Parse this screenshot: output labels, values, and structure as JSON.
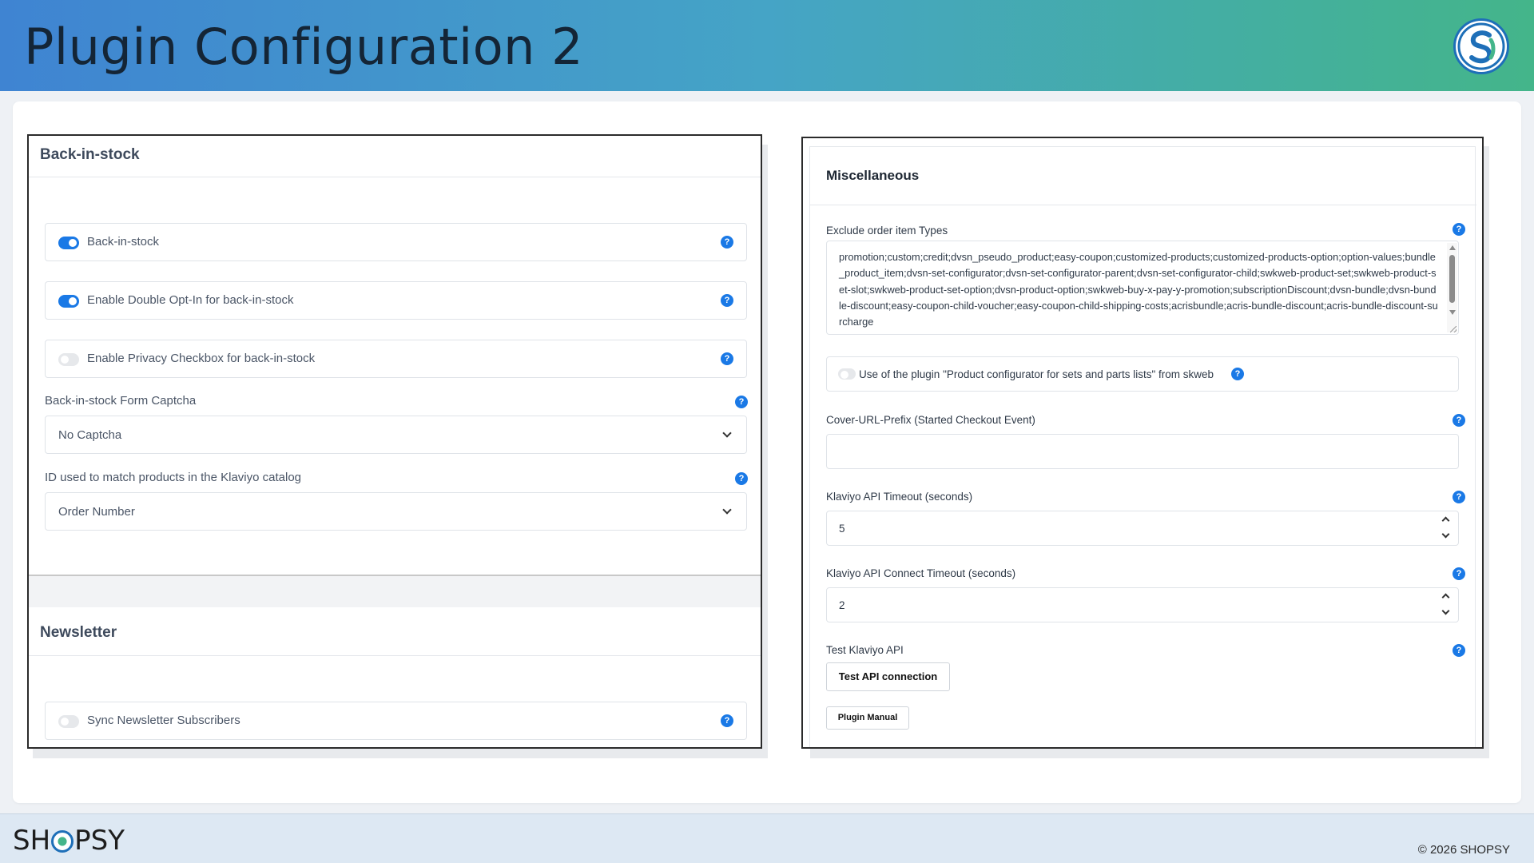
{
  "header": {
    "title": "Plugin Configuration 2"
  },
  "left": {
    "back_in_stock": {
      "title": "Back-in-stock",
      "toggles": [
        {
          "label": "Back-in-stock",
          "enabled": true
        },
        {
          "label": "Enable Double Opt-In for back-in-stock",
          "enabled": true
        },
        {
          "label": "Enable Privacy Checkbox for back-in-stock",
          "enabled": false
        }
      ],
      "captcha_label": "Back-in-stock Form Captcha",
      "captcha_value": "No Captcha",
      "catalog_id_label": "ID used to match products in the Klaviyo catalog",
      "catalog_id_value": "Order Number"
    },
    "newsletter": {
      "title": "Newsletter",
      "toggles": [
        {
          "label": "Sync Newsletter Subscribers",
          "enabled": false
        }
      ]
    }
  },
  "right": {
    "title": "Miscellaneous",
    "exclude_label": "Exclude order item Types",
    "exclude_value": "promotion;custom;credit;dvsn_pseudo_product;easy-coupon;customized-products;customized-products-option;option-values;bundle_product_item;dvsn-set-configurator;dvsn-set-configurator-parent;dvsn-set-configurator-child;swkweb-product-set;swkweb-product-set-slot;swkweb-product-set-option;dvsn-product-option;swkweb-buy-x-pay-y-promotion;subscriptionDiscount;dvsn-bundle;dvsn-bundle-discount;easy-coupon-child-voucher;easy-coupon-child-shipping-costs;acrisbundle;acris-bundle-discount;acris-bundle-discount-surcharge",
    "skweb_toggle_label": "Use of the plugin \"Product configurator for sets and parts lists\" from skweb",
    "skweb_toggle_enabled": false,
    "cover_url_label": "Cover-URL-Prefix (Started Checkout Event)",
    "cover_url_value": "",
    "timeout_label": "Klaviyo API Timeout (seconds)",
    "timeout_value": "5",
    "connect_timeout_label": "Klaviyo API Connect Timeout (seconds)",
    "connect_timeout_value": "2",
    "test_label": "Test Klaviyo API",
    "test_button": "Test API connection",
    "manual_button": "Plugin Manual"
  },
  "footer": {
    "brand_pre": "SH",
    "brand_post": "PSY",
    "copyright": "© 2026 SHOPSY"
  },
  "icons": {
    "help": "question-mark-circle-icon",
    "chevron": "chevron-down-icon",
    "logo": "shopsy-logo-icon"
  },
  "colors": {
    "accent": "#1a79e6",
    "header_gradient_start": "#3f84d2",
    "header_gradient_end": "#44b58a"
  }
}
